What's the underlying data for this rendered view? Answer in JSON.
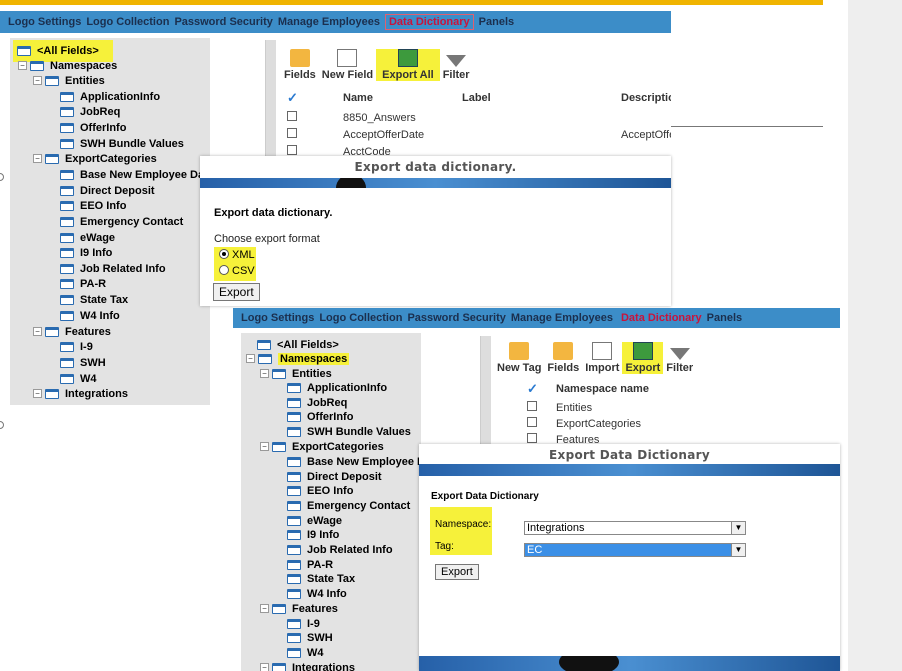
{
  "nav_top": {
    "items": [
      "Logo Settings",
      "Logo Collection",
      "Password Security",
      "Manage Employees",
      "Data Dictionary",
      "Panels"
    ]
  },
  "tree_top": {
    "all_fields": "<All Fields>",
    "namespaces": "Namespaces",
    "entities": "Entities",
    "entity_items": [
      "ApplicationInfo",
      "JobReq",
      "OfferInfo",
      "SWH Bundle Values"
    ],
    "export_categories": "ExportCategories",
    "export_items": [
      "Base New Employee Data",
      "Direct Deposit",
      "EEO Info",
      "Emergency Contact",
      "eWage",
      "I9 Info",
      "Job Related Info",
      "PA-R",
      "State Tax",
      "W4 Info"
    ],
    "features": "Features",
    "feature_items": [
      "I-9",
      "SWH",
      "W4"
    ],
    "integrations": "Integrations"
  },
  "toolbar_top": {
    "fields": "Fields",
    "new_field": "New Field",
    "export_all": "Export All",
    "filter": "Filter"
  },
  "grid_top": {
    "columns": [
      "Name",
      "Label",
      "Description"
    ],
    "rows": [
      {
        "name": "8850_Answers",
        "label": "",
        "description": ""
      },
      {
        "name": "AcceptOfferDate",
        "label": "",
        "description": "AcceptOffe"
      },
      {
        "name": "AcctCode",
        "label": "",
        "description": ""
      }
    ]
  },
  "export_dialog": {
    "title": "Export data dictionary.",
    "heading": "Export data dictionary.",
    "prompt": "Choose export format",
    "options": [
      "XML",
      "CSV"
    ],
    "selected": "XML",
    "button": "Export"
  },
  "nav_bottom": {
    "items": [
      "Logo Settings",
      "Logo Collection",
      "Password Security",
      "Manage Employees",
      "Data Dictionary",
      "Panels"
    ]
  },
  "toolbar_bottom": {
    "new_tag": "New Tag",
    "fields": "Fields",
    "import": "Import",
    "export": "Export",
    "filter": "Filter"
  },
  "grid_bottom": {
    "column": "Namespace name",
    "rows": [
      "Entities",
      "ExportCategories",
      "Features"
    ]
  },
  "ns_dialog": {
    "title": "Export Data Dictionary",
    "heading": "Export Data Dictionary",
    "namespace_label": "Namespace:",
    "namespace_value": "Integrations",
    "tag_label": "Tag:",
    "tag_value": "EC",
    "button": "Export"
  },
  "colors": {
    "highlight": "#f6f13a",
    "nav_bg": "#3c8dc8",
    "accent": "#f0b400"
  }
}
